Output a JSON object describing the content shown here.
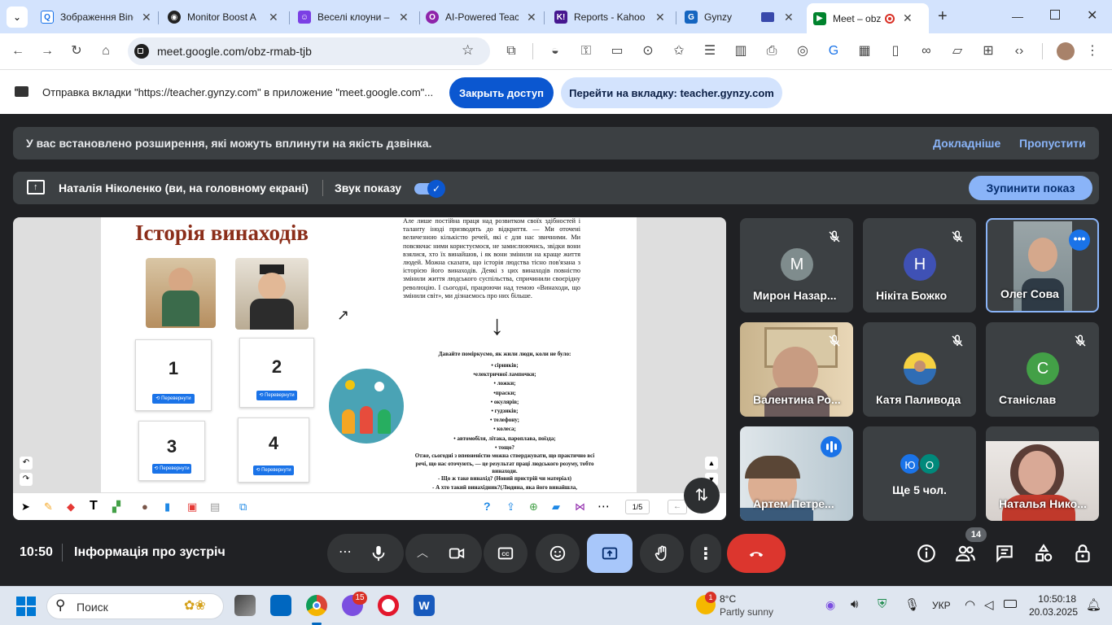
{
  "tabs": [
    {
      "title": "Зображення Bing",
      "favicon": "bing-icon",
      "color": "#1a73e8"
    },
    {
      "title": "Monitor Boost A",
      "favicon": "monitor-icon",
      "color": "#222"
    },
    {
      "title": "Веселі клоуни –",
      "favicon": "clown-icon",
      "color": "#7b3fe4"
    },
    {
      "title": "AI-Powered Teac",
      "favicon": "ai-icon",
      "color": "#8e24aa"
    },
    {
      "title": "Reports - Kahoo",
      "favicon": "kahoot-icon",
      "color": "#46178f"
    },
    {
      "title": "Gynzy",
      "favicon": "gynzy-icon",
      "color": "#1565c0"
    },
    {
      "title": "",
      "favicon": "screen-icon",
      "color": "#3949ab"
    },
    {
      "title": "Meet – obz-rmab-tjb",
      "favicon": "meet-icon",
      "color": "#00832d"
    }
  ],
  "omnibox": {
    "url": "meet.google.com/obz-rmab-tjb"
  },
  "share_bar": {
    "message": "Отправка вкладки \"https://teacher.gynzy.com\" в приложение \"meet.google.com\"...",
    "stop_label": "Закрыть доступ",
    "switch_label": "Перейти на вкладку: teacher.gynzy.com"
  },
  "ext_banner": {
    "text": "У вас встановлено розширення, які можуть вплинути на якість дзвінка.",
    "more": "Докладніше",
    "skip": "Пропустити"
  },
  "present_bar": {
    "presenter": "Наталія Ніколенко (ви, на головному екрані)",
    "sound": "Звук показу",
    "stop": "Зупинити показ"
  },
  "slide": {
    "title": "Історія винаходів",
    "cards": [
      "1",
      "2",
      "3",
      "4"
    ],
    "card_button": "⟲ Перевернути",
    "paragraph": "Але лише постійна праця над розвитком своїх здібностей і таланту іноді призводять до відкриття. — Ми оточені величезною кількістю речей, які є для нас звичними. Ми повсякчас ними користуємося, не замислюючись, звідки вони взялися, хто їх винайшов, і як вони змінили на краще життя людей. Можна сказати, що історія людства тісно пов'язана з історією його винаходів. Деякі з цих винаходів повністю змінили життя людського суспільства, спричинили своєрідну революцію. І сьогодні, працюючи над темою «Винаходи, що змінили світ», ми дізнаємось про них більше.",
    "question": "Давайте поміркуємо, як жили люди, коли не було:",
    "list": [
      "• сірників;",
      "•електричної лампочки;",
      "• ложки;",
      "•праски;",
      "• окулярів;",
      "• гудзиків;",
      "• телефону;",
      "• колеса;",
      "• автомобіля, літака, пароплава, поїзда;",
      "• тощо?"
    ],
    "conclusion": "Отже, сьогодні з впевненістю можна стверджувати, що практично всі речі, що нас оточують, — це результат праці людського розуму, тобто винаходи.",
    "q1": "- Що ж таке винахід? (Новий пристрій чи матеріал)",
    "q2": "- А хто такий винахідник?(Людина, яка його винайшла,",
    "page": "1/5"
  },
  "participants": [
    {
      "name": "Мирон Назар...",
      "initial": "М",
      "color": "#7f8c8d",
      "muted": true
    },
    {
      "name": "Нікіта Божко",
      "initial": "Н",
      "color": "#3f51b5",
      "muted": true
    },
    {
      "name": "Олег Сова",
      "initial": "",
      "color": "",
      "muted": false
    },
    {
      "name": "Валентина Ро...",
      "initial": "",
      "color": "",
      "muted": true
    },
    {
      "name": "Катя Паливода",
      "initial": "",
      "color": "",
      "muted": true
    },
    {
      "name": "Станіслав",
      "initial": "С",
      "color": "#43a047",
      "muted": true
    },
    {
      "name": "Артем Петре...",
      "initial": "",
      "color": "",
      "muted": false
    },
    {
      "name": "Ще 5 чол.",
      "initial": "",
      "color": "",
      "muted": false
    },
    {
      "name": "Наталья Нико...",
      "initial": "",
      "color": "",
      "muted": false
    }
  ],
  "more_people": {
    "a": "Ю",
    "a_color": "#1a73e8",
    "b": "О",
    "b_color": "#00897b"
  },
  "meeting": {
    "time": "10:50",
    "info": "Інформація про зустріч",
    "people_count": "14"
  },
  "taskbar": {
    "search": "Поиск",
    "chrome_badge": "15",
    "weather_badge": "1",
    "temp": "8°C",
    "weather": "Partly sunny",
    "lang": "УКР",
    "clock": "10:50:18",
    "date": "20.03.2025"
  }
}
